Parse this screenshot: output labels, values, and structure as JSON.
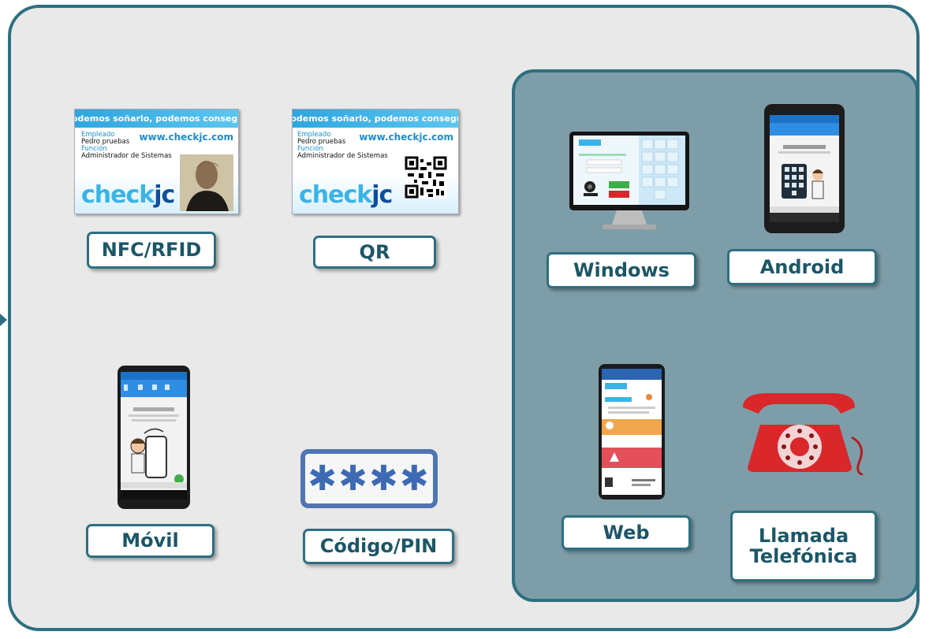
{
  "cards": {
    "nfc": {
      "slogan": "Si podemos soñarlo, podemos conseguirlo",
      "field1_label": "Empleado",
      "field1_value": "Pedro pruebas",
      "field2_label": "Función",
      "field2_value": "Administrador de Sistemas",
      "url": "www.checkjc.com",
      "logo_part1": "check",
      "logo_part2": "jc"
    },
    "qr": {
      "slogan": "Si podemos soñarlo, podemos conseguirlo",
      "field1_label": "Empleado",
      "field1_value": "Pedro pruebas",
      "field2_label": "Función",
      "field2_value": "Administrador de Sistemas",
      "url": "www.checkjc.com",
      "logo_part1": "check",
      "logo_part2": "jc"
    }
  },
  "pin": {
    "symbols": "✱✱✱✱"
  },
  "labels": {
    "nfc": "NFC/RFID",
    "qr": "QR",
    "movil": "Móvil",
    "codigo": "Código/PIN",
    "windows": "Windows",
    "android": "Android",
    "web": "Web",
    "llamada_line1": "Llamada",
    "llamada_line2": "Telefónica"
  },
  "colors": {
    "frame": "#2d6f80",
    "panel": "#7d9ea9",
    "label_text": "#1c5667",
    "pin": "#4f76b2",
    "phone_red": "#d9272a"
  },
  "icons": {
    "nfc_card": "id-card-photo",
    "qr_card": "id-card-qr",
    "mobile": "smartphone-app-icon",
    "pin": "pin-code-icon",
    "windows": "desktop-monitor-icon",
    "android": "android-tablet-icon",
    "web": "web-phone-icon",
    "call": "red-telephone-icon"
  }
}
